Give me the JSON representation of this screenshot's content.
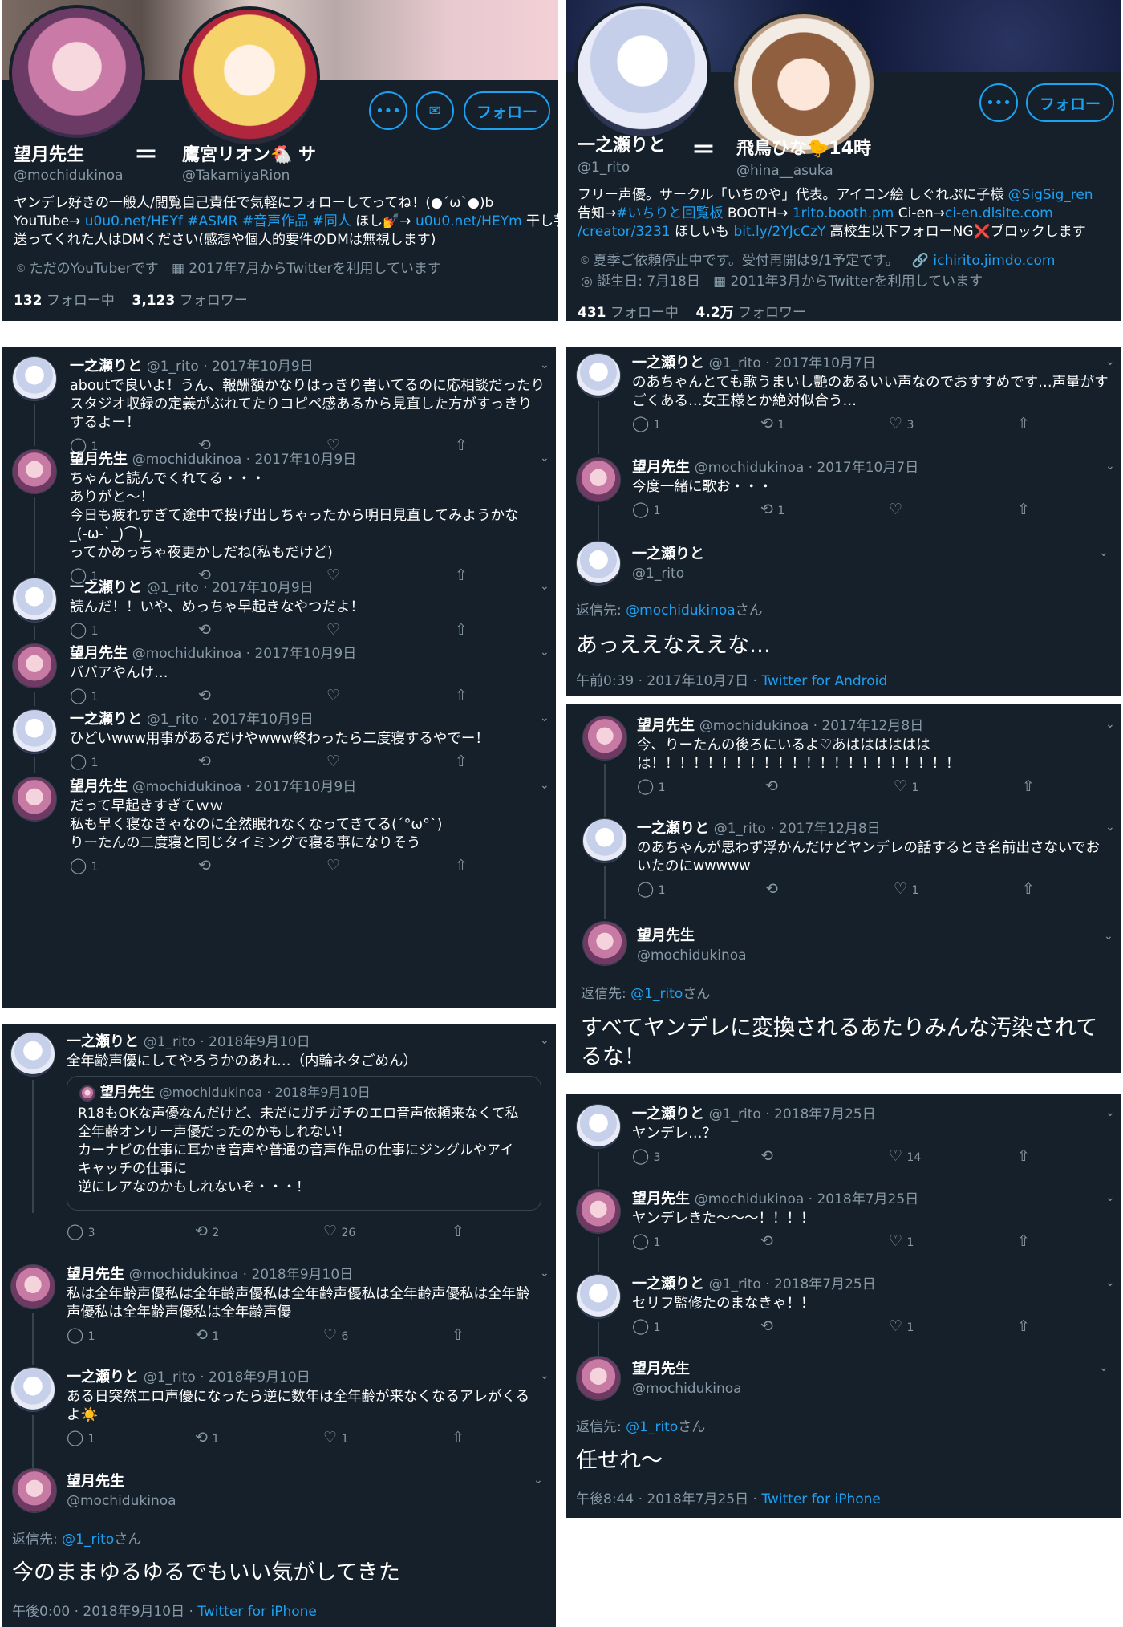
{
  "profile_left": {
    "user1": {
      "name": "望月先生",
      "handle": "@mochidukinoa"
    },
    "equals": "＝",
    "user2": {
      "name": "鷹宮リオン🐔 サ",
      "handle": "@TakamiyaRion"
    },
    "follow_label": "フォロー",
    "bio_line1": "ヤンデレ好きの一般人/閲覧自己責任で気軽にフォローしてってね！(●´ω`●)b",
    "bio_line2_prefix": "YouTube→ ",
    "bio_link1": "u0u0.net/HEYf",
    "bio_tags": " #ASMR #音声作品 #同人",
    "bio_mid": " ほし💅→ ",
    "bio_link2": "u0u0.net/HEYm",
    "bio_line2_suffix": " 干し芋",
    "bio_line3": "送ってくれた人はDMください(感想や個人的要件のDMは無視します)",
    "location": "ただのYouTuberです",
    "joined": "2017年7月からTwitterを利用しています",
    "following_count": "132",
    "following_label": "フォロー中",
    "followers_count": "3,123",
    "followers_label": "フォロワー"
  },
  "profile_right": {
    "user1": {
      "name": "一之瀬りと",
      "handle": "@1_rito"
    },
    "equals": "＝",
    "user2": {
      "name": "飛鳥ひな🐤14時",
      "handle": "@hina__asuka"
    },
    "follow_label": "フォロー",
    "bio_line1_prefix": "フリー声優。サークル「いちのや」代表。アイコン絵 しぐれぷに子様 ",
    "bio_line1_link": "@SigSig_ren",
    "bio_line2_prefix": "告知→",
    "bio_line2_link1": "#いちりと回覧板",
    "bio_line2_mid": " BOOTH→ ",
    "bio_line2_link2": "1rito.booth.pm",
    "bio_line2_mid2": "  Ci-en→",
    "bio_line2_link3": "ci-en.dlsite.com",
    "bio_line3_link1": "/creator/3231",
    "bio_line3_mid": " ほしいも ",
    "bio_line3_link2": "bit.ly/2YJcCzY",
    "bio_line3_suffix": " 高校生以下フォローNG❌ブロックします",
    "location": "夏季ご依頼停止中です。受付再開は9/1予定です。",
    "website": "ichirito.jimdo.com",
    "birthday": "誕生日: 7月18日",
    "joined": "2011年3月からTwitterを利用しています",
    "following_count": "431",
    "following_label": "フォロー中",
    "followers_count": "4.2万",
    "followers_label": "フォロワー"
  },
  "thread_a": [
    {
      "name": "一之瀬りと",
      "meta": "@1_rito · 2017年10月9日",
      "lines": [
        "aboutで良いよ！うん、報酬額かなりはっきり書いてるのに応相談だったり",
        "スタジオ収録の定義がぶれてたりコピペ感あるから見直した方がすっきり",
        "するよー！"
      ],
      "reply": "1",
      "rt": "",
      "like": ""
    },
    {
      "name": "望月先生",
      "meta": "@mochidukinoa · 2017年10月9日",
      "lines": [
        "ちゃんと読んでくれてる・・・",
        "ありがと～！",
        "今日も疲れすぎて途中で投げ出しちゃったから明日見直してみようかな",
        "_(-ω-`_)⌒)_",
        "ってかめっちゃ夜更かしだね(私もだけど)"
      ],
      "reply": "1",
      "rt": "",
      "like": ""
    },
    {
      "name": "一之瀬りと",
      "meta": "@1_rito · 2017年10月9日",
      "lines": [
        "読んだ！！いや、めっちゃ早起きなやつだよ！"
      ],
      "reply": "1",
      "rt": "",
      "like": ""
    },
    {
      "name": "望月先生",
      "meta": "@mochidukinoa · 2017年10月9日",
      "lines": [
        "ババアやんけ…"
      ],
      "reply": "1",
      "rt": "",
      "like": ""
    },
    {
      "name": "一之瀬りと",
      "meta": "@1_rito · 2017年10月9日",
      "lines": [
        "ひどいwww用事があるだけやwww終わったら二度寝するやでー！"
      ],
      "reply": "1",
      "rt": "",
      "like": ""
    },
    {
      "name": "望月先生",
      "meta": "@mochidukinoa · 2017年10月9日",
      "lines": [
        "だって早起きすぎてｗｗ",
        "私も早く寝なきゃなのに全然眠れなくなってきてる(´°ω°`)",
        "りーたんの二度寝と同じタイミングで寝る事になりそう"
      ],
      "reply": "1",
      "rt": "",
      "like": ""
    }
  ],
  "thread_b": {
    "tweets": [
      {
        "name": "一之瀬りと",
        "meta": "@1_rito · 2017年10月7日",
        "lines": [
          "のあちゃんとても歌うまいし艶のあるいい声なのでおすすめです…声量がす",
          "ごくある…女王様とか絶対似合う…"
        ],
        "reply": "1",
        "rt": "1",
        "like": "3"
      },
      {
        "name": "望月先生",
        "meta": "@mochidukinoa · 2017年10月7日",
        "lines": [
          "今度一緒に歌お・・・"
        ],
        "reply": "1",
        "rt": "1",
        "like": ""
      }
    ],
    "main": {
      "name": "一之瀬りと",
      "handle": "@1_rito",
      "reply_to_prefix": "返信先: ",
      "reply_to_link": "@mochidukinoa",
      "reply_to_suffix": "さん",
      "text": "あっええなええな…",
      "time": "午前0:39 · 2017年10月7日 · ",
      "client": "Twitter for Android"
    }
  },
  "thread_c": {
    "tweets": [
      {
        "name": "望月先生",
        "meta": "@mochidukinoa · 2017年12月8日",
        "lines": [
          "今、りーたんの後ろにいるよ♡あはははははは",
          "は！！！！！！！！！！！！！！！！！！！！！！"
        ],
        "reply": "1",
        "rt": "",
        "like": "1"
      },
      {
        "name": "一之瀬りと",
        "meta": "@1_rito · 2017年12月8日",
        "lines": [
          "のあちゃんが思わず浮かんだけどヤンデレの話するとき名前出さないでお",
          "いたのにwwwww"
        ],
        "reply": "1",
        "rt": "",
        "like": "1"
      }
    ],
    "main": {
      "name": "望月先生",
      "handle": "@mochidukinoa",
      "reply_to_prefix": "返信先: ",
      "reply_to_link": "@1_rito",
      "reply_to_suffix": "さん",
      "text_line1": "すべてヤンデレに変換されるあたりみんな汚染されて",
      "text_line2": "るな！"
    }
  },
  "thread_d": {
    "first": {
      "name": "一之瀬りと",
      "meta": "@1_rito · 2018年9月10日",
      "lines": [
        "全年齢声優にしてやろうかのあれ…（内輪ネタごめん）"
      ],
      "reply": "3",
      "rt": "2",
      "like": "26"
    },
    "quote": {
      "name": "望月先生",
      "meta": "@mochidukinoa · 2018年9月10日",
      "lines": [
        "R18もOKな声優なんだけど、未だにガチガチのエロ音声依頼来なくて私",
        "全年齢オンリー声優だったのかもしれない！",
        "カーナビの仕事に耳かき音声や普通の音声作品の仕事にジングルやアイ",
        "キャッチの仕事に",
        "逆にレアなのかもしれないぞ・・・！"
      ]
    },
    "tweets": [
      {
        "name": "望月先生",
        "meta": "@mochidukinoa · 2018年9月10日",
        "lines": [
          "私は全年齢声優私は全年齢声優私は全年齢声優私は全年齢声優私は全年齢",
          "声優私は全年齢声優私は全年齢声優"
        ],
        "reply": "1",
        "rt": "1",
        "like": "6"
      },
      {
        "name": "一之瀬りと",
        "meta": "@1_rito · 2018年9月10日",
        "lines": [
          "ある日突然エロ声優になったら逆に数年は全年齢が来なくなるアレがくる",
          "よ☀️"
        ],
        "reply": "1",
        "rt": "1",
        "like": "1"
      }
    ],
    "main": {
      "name": "望月先生",
      "handle": "@mochidukinoa",
      "reply_to_prefix": "返信先: ",
      "reply_to_link": "@1_rito",
      "reply_to_suffix": "さん",
      "text": "今のままゆるゆるでもいい気がしてきた",
      "time": "午後0:00 · 2018年9月10日 · ",
      "client": "Twitter for iPhone"
    }
  },
  "thread_e": {
    "tweets": [
      {
        "name": "一之瀬りと",
        "meta": "@1_rito · 2018年7月25日",
        "lines": [
          "ヤンデレ…？"
        ],
        "reply": "3",
        "rt": "",
        "like": "14"
      },
      {
        "name": "望月先生",
        "meta": "@mochidukinoa · 2018年7月25日",
        "lines": [
          "ヤンデレきた～～～！！！！"
        ],
        "reply": "1",
        "rt": "",
        "like": "1"
      },
      {
        "name": "一之瀬りと",
        "meta": "@1_rito · 2018年7月25日",
        "lines": [
          "セリフ監修たのまなきゃ！！"
        ],
        "reply": "1",
        "rt": "",
        "like": "1"
      }
    ],
    "main": {
      "name": "望月先生",
      "handle": "@mochidukinoa",
      "reply_to_prefix": "返信先: ",
      "reply_to_link": "@1_rito",
      "reply_to_suffix": "さん",
      "text": "任せれ～",
      "time": "午後8:44 · 2018年7月25日 · ",
      "client": "Twitter for iPhone"
    }
  },
  "icons": {
    "reply": "reply-icon",
    "retweet": "retweet-icon",
    "like": "heart-icon",
    "share": "share-icon",
    "more": "more-icon",
    "mail": "mail-icon",
    "chevron": "chevron-down-icon",
    "location": "location-icon",
    "calendar": "calendar-icon",
    "link": "link-icon",
    "birthday": "balloon-icon"
  },
  "colors": {
    "background": "#15202b",
    "accent": "#1da1f2",
    "secondary_text": "#8899a6",
    "border": "#38444d"
  }
}
